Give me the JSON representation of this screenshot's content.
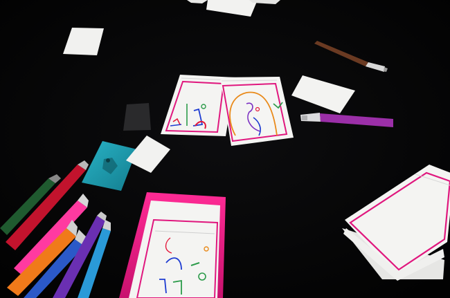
{
  "scene": {
    "subject": "drawing-cards-markers-on-dark-table",
    "colors": {
      "background": "#050505",
      "card_white": "#f4f4f2",
      "card_border_magenta": "#e0177e",
      "teal_card": "#1fa1b4",
      "eraser": "#2a2a2c"
    },
    "objects": [
      {
        "name": "blank-white-card",
        "color": "#f1f1ef"
      },
      {
        "name": "drawn-card-left",
        "color": "#e0177e"
      },
      {
        "name": "drawn-card-right",
        "color": "#e0177e"
      },
      {
        "name": "eraser",
        "color": "#2a2a2c"
      },
      {
        "name": "teal-tag-card",
        "color": "#1fa1b4"
      },
      {
        "name": "magenta-card-box",
        "color": "#e81a86"
      },
      {
        "name": "card-stack-right",
        "color": "#e0177e"
      },
      {
        "name": "brown-marker",
        "color": "#6a3a22"
      },
      {
        "name": "purple-marker",
        "color": "#9b2fa8"
      },
      {
        "name": "marker-pile",
        "color": "#ff3aa0"
      }
    ]
  }
}
